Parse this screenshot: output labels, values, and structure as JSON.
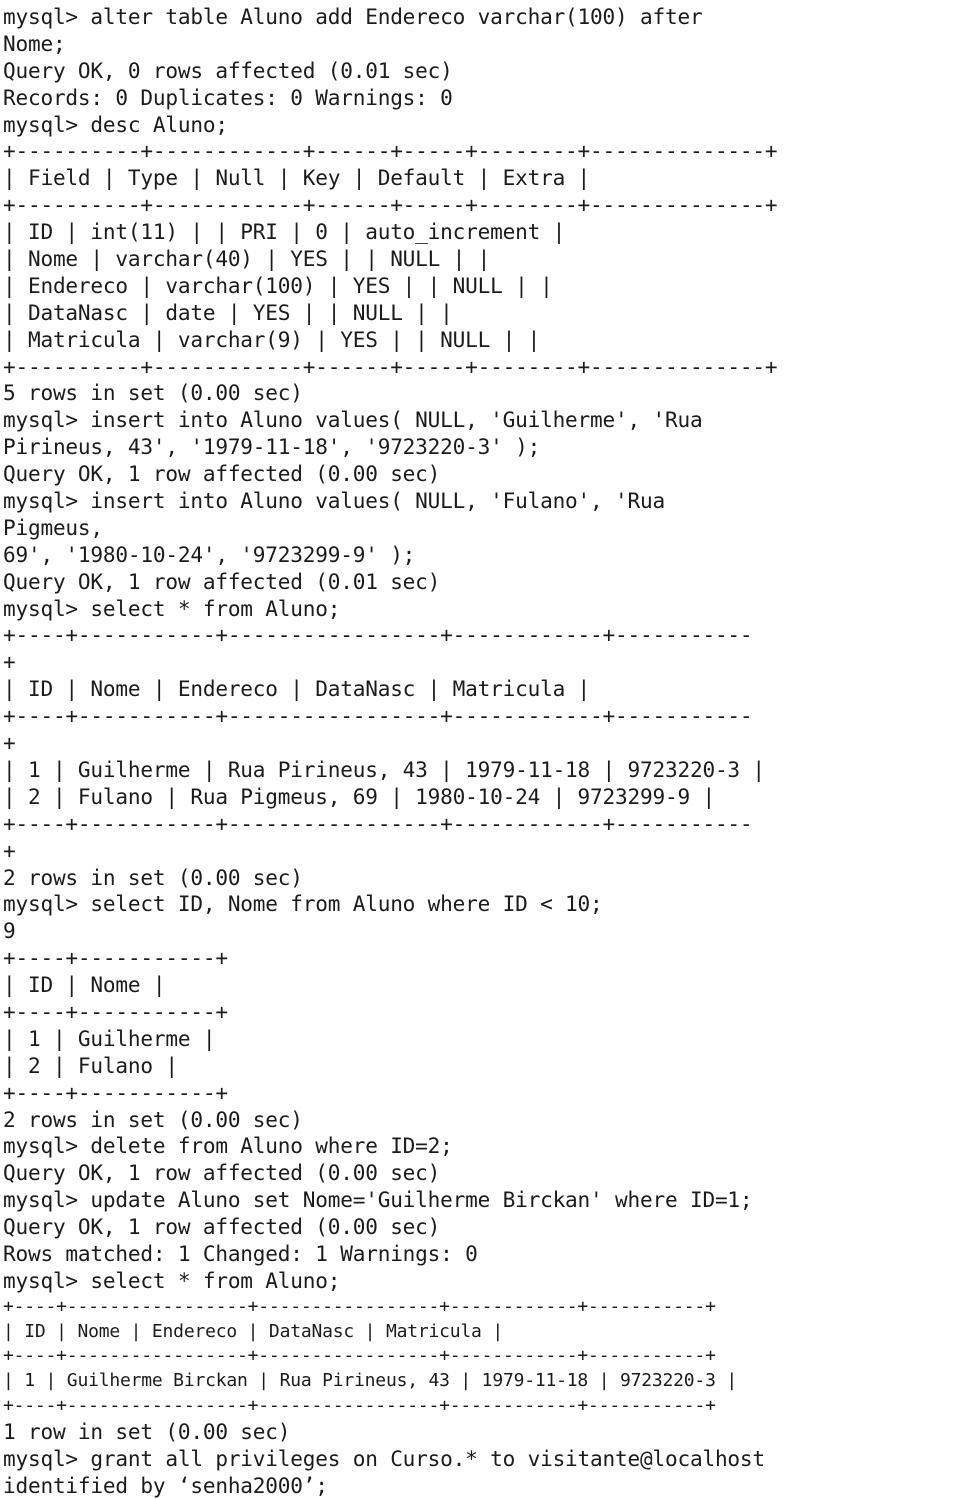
{
  "document": {
    "kind": "terminal-transcript",
    "app": "mysql",
    "prompt": "mysql>",
    "background_color": "#ffffff",
    "text_color": "#1b1b1b"
  },
  "blocks": [
    {
      "id": "block-main",
      "size": "large",
      "lines": [
        "mysql> alter table Aluno add Endereco varchar(100) after",
        "Nome;",
        "Query OK, 0 rows affected (0.01 sec)",
        "Records: 0 Duplicates: 0 Warnings: 0",
        "mysql> desc Aluno;",
        "+----------+------------+------+-----+--------+--------------+",
        "| Field | Type | Null | Key | Default | Extra |",
        "+----------+------------+------+-----+--------+--------------+",
        "| ID | int(11) | | PRI | 0 | auto_increment |",
        "| Nome | varchar(40) | YES | | NULL | |",
        "| Endereco | varchar(100) | YES | | NULL | |",
        "| DataNasc | date | YES | | NULL | |",
        "| Matricula | varchar(9) | YES | | NULL | |",
        "+----------+------------+------+-----+--------+--------------+",
        "5 rows in set (0.00 sec)",
        "mysql> insert into Aluno values( NULL, 'Guilherme', 'Rua",
        "Pirineus, 43', '1979-11-18', '9723220-3' );",
        "Query OK, 1 row affected (0.00 sec)",
        "mysql> insert into Aluno values( NULL, 'Fulano', 'Rua",
        "Pigmeus,",
        "69', '1980-10-24', '9723299-9' );",
        "Query OK, 1 row affected (0.01 sec)",
        "mysql> select * from Aluno;",
        "+----+-----------+-----------------+------------+-----------",
        "+",
        "| ID | Nome | Endereco | DataNasc | Matricula |",
        "+----+-----------+-----------------+------------+-----------",
        "+",
        "| 1 | Guilherme | Rua Pirineus, 43 | 1979-11-18 | 9723220-3 |",
        "| 2 | Fulano | Rua Pigmeus, 69 | 1980-10-24 | 9723299-9 |",
        "+----+-----------+-----------------+------------+-----------",
        "+",
        "2 rows in set (0.00 sec)",
        "mysql> select ID, Nome from Aluno where ID < 10;",
        "9",
        "+----+-----------+",
        "| ID | Nome |",
        "+----+-----------+",
        "| 1 | Guilherme |",
        "| 2 | Fulano |",
        "+----+-----------+",
        "2 rows in set (0.00 sec)",
        "mysql> delete from Aluno where ID=2;",
        "Query OK, 1 row affected (0.00 sec)",
        "mysql> update Aluno set Nome='Guilherme Birckan' where ID=1;",
        "Query OK, 1 row affected (0.00 sec)",
        "Rows matched: 1 Changed: 1 Warnings: 0",
        "mysql> select * from Aluno;"
      ]
    },
    {
      "id": "block-small",
      "size": "small",
      "lines": [
        "+----+-----------------+-----------------+------------+-----------+",
        "| ID | Nome | Endereco | DataNasc | Matricula |",
        "+----+-----------------+-----------------+------------+-----------+",
        "| 1 | Guilherme Birckan | Rua Pirineus, 43 | 1979-11-18 | 9723220-3 |",
        "+----+-----------------+-----------------+------------+-----------+"
      ]
    },
    {
      "id": "block-tail",
      "size": "large",
      "lines": [
        "1 row in set (0.00 sec)",
        "mysql> grant all privileges on Curso.* to visitante@localhost",
        "identified by ‘senha2000’;"
      ]
    }
  ],
  "statements": [
    {
      "command": "alter table Aluno add Endereco varchar(100) after Nome;",
      "result": "Query OK, 0 rows affected (0.01 sec)",
      "extra": "Records: 0 Duplicates: 0 Warnings: 0"
    },
    {
      "command": "desc Aluno;",
      "table": {
        "headers": [
          "Field",
          "Type",
          "Null",
          "Key",
          "Default",
          "Extra"
        ],
        "rows": [
          [
            "ID",
            "int(11)",
            "",
            "PRI",
            "0",
            "auto_increment"
          ],
          [
            "Nome",
            "varchar(40)",
            "YES",
            "",
            "NULL",
            ""
          ],
          [
            "Endereco",
            "varchar(100)",
            "YES",
            "",
            "NULL",
            ""
          ],
          [
            "DataNasc",
            "date",
            "YES",
            "",
            "NULL",
            ""
          ],
          [
            "Matricula",
            "varchar(9)",
            "YES",
            "",
            "NULL",
            ""
          ]
        ]
      },
      "result": "5 rows in set (0.00 sec)"
    },
    {
      "command": "insert into Aluno values( NULL, 'Guilherme', 'Rua Pirineus, 43', '1979-11-18', '9723220-3' );",
      "result": "Query OK, 1 row affected (0.00 sec)"
    },
    {
      "command": "insert into Aluno values( NULL, 'Fulano', 'Rua Pigmeus, 69', '1980-10-24', '9723299-9' );",
      "result": "Query OK, 1 row affected (0.01 sec)"
    },
    {
      "command": "select * from Aluno;",
      "table": {
        "headers": [
          "ID",
          "Nome",
          "Endereco",
          "DataNasc",
          "Matricula"
        ],
        "rows": [
          [
            "1",
            "Guilherme",
            "Rua Pirineus, 43",
            "1979-11-18",
            "9723220-3"
          ],
          [
            "2",
            "Fulano",
            "Rua Pigmeus, 69",
            "1980-10-24",
            "9723299-9"
          ]
        ]
      },
      "result": "2 rows in set (0.00 sec)"
    },
    {
      "command": "select ID, Nome from Aluno where ID < 10;",
      "stray": "9",
      "table": {
        "headers": [
          "ID",
          "Nome"
        ],
        "rows": [
          [
            "1",
            "Guilherme"
          ],
          [
            "2",
            "Fulano"
          ]
        ]
      },
      "result": "2 rows in set (0.00 sec)"
    },
    {
      "command": "delete from Aluno where ID=2;",
      "result": "Query OK, 1 row affected (0.00 sec)"
    },
    {
      "command": "update Aluno set Nome='Guilherme Birckan' where ID=1;",
      "result": "Query OK, 1 row affected (0.00 sec)",
      "extra": "Rows matched: 1 Changed: 1 Warnings: 0"
    },
    {
      "command": "select * from Aluno;",
      "table": {
        "headers": [
          "ID",
          "Nome",
          "Endereco",
          "DataNasc",
          "Matricula"
        ],
        "rows": [
          [
            "1",
            "Guilherme Birckan",
            "Rua Pirineus, 43",
            "1979-11-18",
            "9723220-3"
          ]
        ]
      },
      "result": "1 row in set (0.00 sec)"
    },
    {
      "command": "grant all privileges on Curso.* to visitante@localhost identified by ‘senha2000’;"
    }
  ]
}
